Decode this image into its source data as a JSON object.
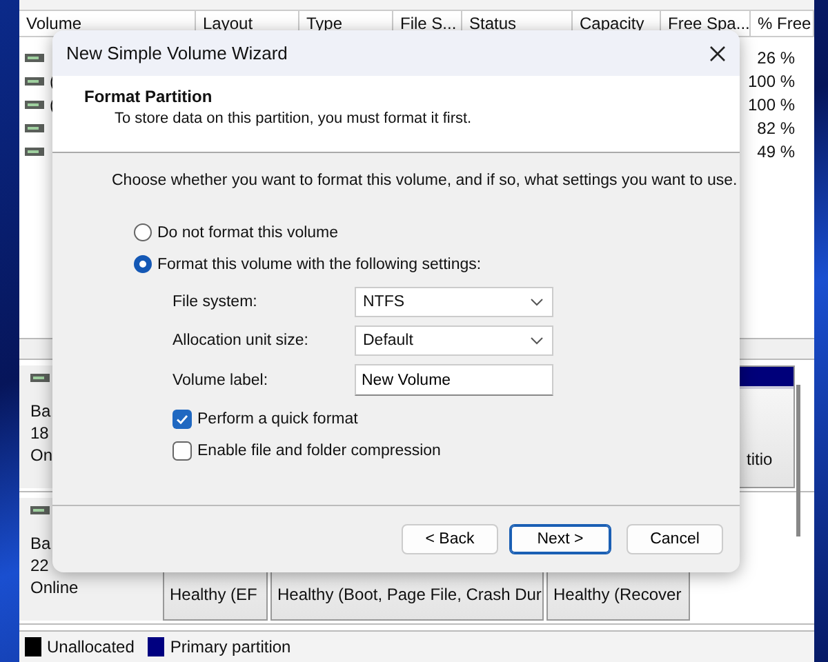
{
  "volume_list": {
    "columns": [
      "Volume",
      "Layout",
      "Type",
      "File S...",
      "Status",
      "Capacity",
      "Free Spa...",
      "% Free"
    ],
    "rows": [
      {
        "percent_free": "26 %"
      },
      {
        "volume": "(",
        "percent_free": "100 %"
      },
      {
        "volume": "(",
        "percent_free": "100 %"
      },
      {
        "percent_free": "82 %"
      },
      {
        "percent_free": "49 %"
      }
    ]
  },
  "disks": [
    {
      "lines": [
        "Ba",
        "18",
        "On"
      ],
      "partitions": [
        {
          "status": "titio"
        }
      ]
    },
    {
      "lines": [
        "Ba",
        "22",
        "Online"
      ],
      "partitions": [
        {
          "status": "Healthy (EF"
        },
        {
          "status": "Healthy (Boot, Page File, Crash Dur"
        },
        {
          "status": "Healthy (Recover"
        }
      ]
    }
  ],
  "legend": [
    {
      "label": "Unallocated",
      "color": "#000000"
    },
    {
      "label": "Primary partition",
      "color": "#000080"
    }
  ],
  "dialog": {
    "title": "New Simple Volume Wizard",
    "heading": "Format Partition",
    "subtitle": "To store data on this partition, you must format it first.",
    "instruction": "Choose whether you want to format this volume, and if so, what settings you want to use.",
    "options": [
      {
        "label": "Do not format this volume",
        "selected": false
      },
      {
        "label": "Format this volume with the following settings:",
        "selected": true
      }
    ],
    "fields": [
      {
        "kind": "dropdown",
        "label": "File system:",
        "value": "NTFS"
      },
      {
        "kind": "dropdown",
        "label": "Allocation unit size:",
        "value": "Default"
      },
      {
        "kind": "text",
        "label": "Volume label:",
        "value": "New Volume"
      }
    ],
    "checkboxes": [
      {
        "label": "Perform a quick format",
        "checked": true
      },
      {
        "label": "Enable file and folder compression",
        "checked": false
      }
    ],
    "buttons": [
      {
        "label": "< Back",
        "default": false
      },
      {
        "label": "Next >",
        "default": true
      },
      {
        "label": "Cancel",
        "default": false
      }
    ]
  }
}
